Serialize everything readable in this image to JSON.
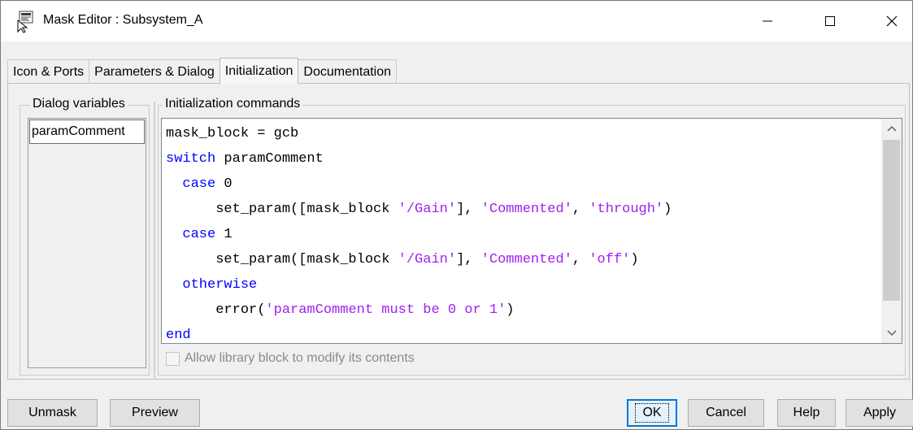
{
  "window": {
    "title": "Mask Editor : Subsystem_A",
    "controls": {
      "minimize": "minimize-icon",
      "maximize": "maximize-icon",
      "close": "close-icon"
    }
  },
  "tabs": [
    {
      "label": "Icon & Ports",
      "active": false
    },
    {
      "label": "Parameters & Dialog",
      "active": false
    },
    {
      "label": "Initialization",
      "active": true
    },
    {
      "label": "Documentation",
      "active": false
    }
  ],
  "dialog_variables": {
    "label": "Dialog variables",
    "items": [
      "paramComment"
    ]
  },
  "initialization": {
    "label": "Initialization commands",
    "code_lines": [
      [
        {
          "t": "mask_block = gcb",
          "c": ""
        }
      ],
      [
        {
          "t": "switch",
          "c": "kw"
        },
        {
          "t": " paramComment",
          "c": ""
        }
      ],
      [
        {
          "t": "  ",
          "c": ""
        },
        {
          "t": "case",
          "c": "kw"
        },
        {
          "t": " 0",
          "c": ""
        }
      ],
      [
        {
          "t": "      set_param([mask_block ",
          "c": ""
        },
        {
          "t": "'/Gain'",
          "c": "str"
        },
        {
          "t": "], ",
          "c": ""
        },
        {
          "t": "'Commented'",
          "c": "str"
        },
        {
          "t": ", ",
          "c": ""
        },
        {
          "t": "'through'",
          "c": "str"
        },
        {
          "t": ")",
          "c": ""
        }
      ],
      [
        {
          "t": "  ",
          "c": ""
        },
        {
          "t": "case",
          "c": "kw"
        },
        {
          "t": " 1",
          "c": ""
        }
      ],
      [
        {
          "t": "      set_param([mask_block ",
          "c": ""
        },
        {
          "t": "'/Gain'",
          "c": "str"
        },
        {
          "t": "], ",
          "c": ""
        },
        {
          "t": "'Commented'",
          "c": "str"
        },
        {
          "t": ", ",
          "c": ""
        },
        {
          "t": "'off'",
          "c": "str"
        },
        {
          "t": ")",
          "c": ""
        }
      ],
      [
        {
          "t": "  ",
          "c": ""
        },
        {
          "t": "otherwise",
          "c": "kw"
        }
      ],
      [
        {
          "t": "      error(",
          "c": ""
        },
        {
          "t": "'paramComment must be 0 or 1'",
          "c": "str"
        },
        {
          "t": ")",
          "c": ""
        }
      ],
      [
        {
          "t": "end",
          "c": "kw"
        }
      ]
    ],
    "allow_library_label": "Allow library block to modify its contents",
    "allow_library_checked": false
  },
  "buttons": {
    "unmask": "Unmask",
    "preview": "Preview",
    "ok": "OK",
    "cancel": "Cancel",
    "help": "Help",
    "apply": "Apply"
  },
  "colors": {
    "keyword": "#0000ff",
    "string": "#a020f0",
    "focus_border": "#0078d7"
  }
}
